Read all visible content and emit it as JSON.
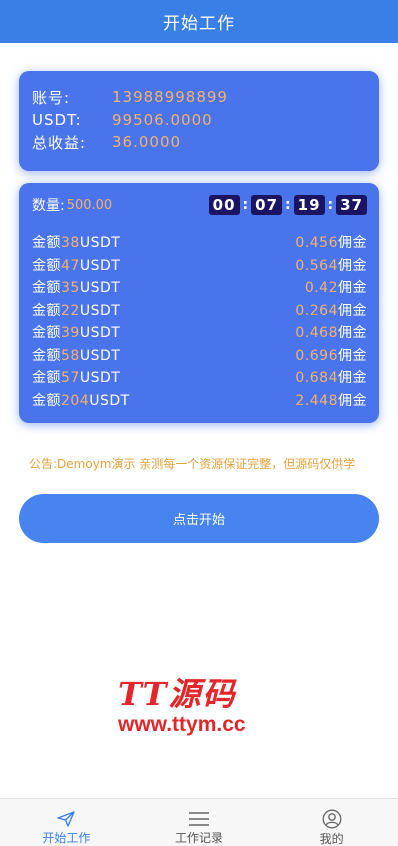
{
  "header": {
    "title": "开始工作"
  },
  "account": {
    "rows": [
      {
        "label": "账号:",
        "value": "13988998899"
      },
      {
        "label": "USDT:",
        "value": "99506.0000"
      },
      {
        "label": "总收益:",
        "value": "36.0000"
      }
    ]
  },
  "work": {
    "qty_label": "数量:",
    "qty_value": "500.00",
    "timer": {
      "h": "00",
      "m": "07",
      "s": "19",
      "ms": "37",
      "sep": ":"
    },
    "items": [
      {
        "prefix": "金额",
        "amount": "38",
        "unit": "USDT",
        "commission": "0.456",
        "suffix": "佣金"
      },
      {
        "prefix": "金额",
        "amount": "47",
        "unit": "USDT",
        "commission": "0.564",
        "suffix": "佣金"
      },
      {
        "prefix": "金额",
        "amount": "35",
        "unit": "USDT",
        "commission": "0.42",
        "suffix": "佣金"
      },
      {
        "prefix": "金额",
        "amount": "22",
        "unit": "USDT",
        "commission": "0.264",
        "suffix": "佣金"
      },
      {
        "prefix": "金额",
        "amount": "39",
        "unit": "USDT",
        "commission": "0.468",
        "suffix": "佣金"
      },
      {
        "prefix": "金额",
        "amount": "58",
        "unit": "USDT",
        "commission": "0.696",
        "suffix": "佣金"
      },
      {
        "prefix": "金额",
        "amount": "57",
        "unit": "USDT",
        "commission": "0.684",
        "suffix": "佣金"
      },
      {
        "prefix": "金额",
        "amount": "204",
        "unit": "USDT",
        "commission": "2.448",
        "suffix": "佣金"
      }
    ]
  },
  "notice": "公告:Demoym演示 亲测每一个资源保证完整，但源码仅供学",
  "start_button": "点击开始",
  "watermark": {
    "line1": "TT源码",
    "line2": "www.ttym.cc"
  },
  "tabbar": {
    "items": [
      {
        "label": "开始工作",
        "icon": "send-icon",
        "active": true
      },
      {
        "label": "工作记录",
        "icon": "menu-icon",
        "active": false
      },
      {
        "label": "我的",
        "icon": "user-icon",
        "active": false
      }
    ]
  },
  "colors": {
    "accent": "#3a7fe6",
    "card": "#4a74ec",
    "highlight": "#f5b26a",
    "notice": "#e5a23c",
    "timer_bg": "#1b1463"
  }
}
